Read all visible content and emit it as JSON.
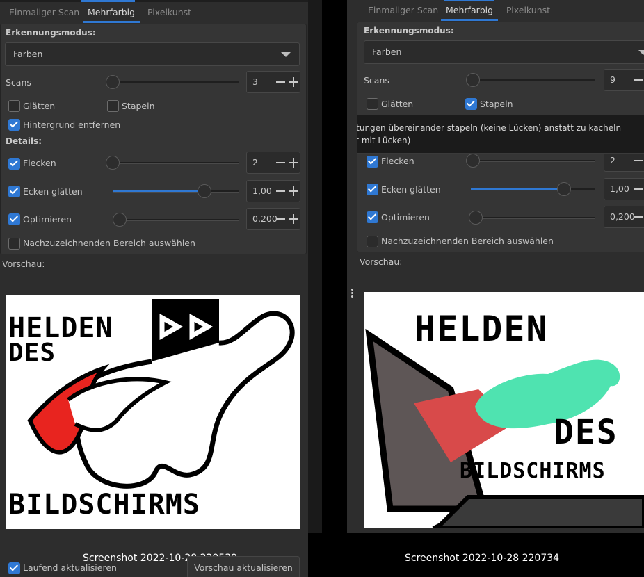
{
  "tabs": [
    "Einmaliger Scan",
    "Mehrfarbig",
    "Pixelkunst"
  ],
  "labels": {
    "detection_mode": "Erkennungsmodus:",
    "scans": "Scans",
    "smooth": "Glätten",
    "stack": "Stapeln",
    "remove_background": "Hintergrund entfernen",
    "details": "Details:",
    "speckles": "Flecken",
    "smooth_corners": "Ecken glätten",
    "optimize": "Optimieren",
    "select_region": "Nachzuzeichnenden Bereich auswählen",
    "preview": "Vorschau:"
  },
  "left": {
    "mode_value": "Farben",
    "scans_value": "3",
    "speckles_value": "2",
    "corners_value": "1,00",
    "optimize_value": "0,200",
    "checks": {
      "smooth": false,
      "stack": false,
      "remove_background": true,
      "speckles": true,
      "smooth_corners": true,
      "optimize": true,
      "select_region": false
    },
    "live_update_label": "Laufend aktualisieren",
    "update_preview_label": "Vorschau aktualisieren",
    "caption": "Screenshot 2022-10-28 220539",
    "logo": {
      "line1": "HELDEN",
      "line2": "DES",
      "line3": "BILDSCHIRMS"
    }
  },
  "right": {
    "mode_value": "Farben",
    "scans_value": "9",
    "speckles_value": "2",
    "corners_value": "1,00",
    "optimize_value": "0,200",
    "checks": {
      "smooth": false,
      "stack": true,
      "remove_background": true,
      "speckles": true,
      "smooth_corners": true,
      "optimize": true,
      "select_region": false
    },
    "tooltip": "Abtastungen übereinander stapeln (keine Lücken) anstatt zu kacheln (meist mit Lücken)",
    "caption": "Screenshot 2022-10-28 220734",
    "logo": {
      "line1": "HELDEN",
      "line2": "DES",
      "line3": "BILDSCHIRMS"
    }
  },
  "colors": {
    "accent": "#2f78d3",
    "logo_red": "#e8241f",
    "logo_mint": "#4fe3b0"
  }
}
